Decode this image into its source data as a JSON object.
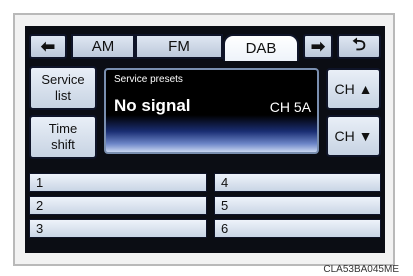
{
  "tabs": {
    "back_arrow": "⬅",
    "am": "AM",
    "fm": "FM",
    "dab": "DAB",
    "forward_arrow": "➡",
    "return": "⮌"
  },
  "side_buttons": {
    "service_list": "Service\nlist",
    "time_shift": "Time\nshift"
  },
  "display": {
    "label": "Service presets",
    "status": "No signal",
    "channel": "CH  5A"
  },
  "channel_buttons": {
    "up": "CH ▲",
    "down": "CH ▼"
  },
  "presets": [
    "1",
    "2",
    "3",
    "4",
    "5",
    "6"
  ],
  "caption": "CLA53BA045ME",
  "colors": {
    "bezel": "#0b0d14",
    "button_top": "#e9eff7",
    "button_bottom": "#c7d3e3",
    "display_glow": "#6d86c8"
  }
}
